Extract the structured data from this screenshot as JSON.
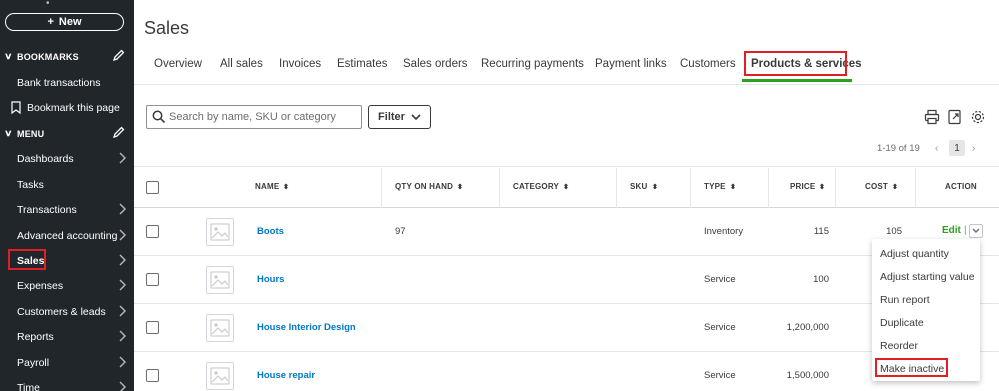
{
  "sidebar": {
    "new_label": "New",
    "bookmarks_label": "BOOKMARKS",
    "bookmark_items": [
      {
        "label": "Bank transactions"
      },
      {
        "label": "Bookmark this page"
      }
    ],
    "menu_label": "MENU",
    "menu_items": [
      {
        "label": "Dashboards"
      },
      {
        "label": "Tasks"
      },
      {
        "label": "Transactions"
      },
      {
        "label": "Advanced accounting"
      },
      {
        "label": "Sales"
      },
      {
        "label": "Expenses"
      },
      {
        "label": "Customers & leads"
      },
      {
        "label": "Reports"
      },
      {
        "label": "Payroll"
      },
      {
        "label": "Time"
      }
    ],
    "colors": {
      "bg": "#21262b",
      "text": "#ffffff"
    }
  },
  "page": {
    "title": "Sales"
  },
  "tabs": [
    {
      "label": "Overview"
    },
    {
      "label": "All sales"
    },
    {
      "label": "Invoices"
    },
    {
      "label": "Estimates"
    },
    {
      "label": "Sales orders"
    },
    {
      "label": "Recurring payments"
    },
    {
      "label": "Payment links"
    },
    {
      "label": "Customers"
    },
    {
      "label": "Products & services"
    }
  ],
  "active_tab": "Products & services",
  "toolbar": {
    "search_placeholder": "Search by name, SKU or category",
    "filter_label": "Filter",
    "icons": [
      "print-icon",
      "export-icon",
      "settings-icon"
    ]
  },
  "pager": {
    "range_text": "1-19 of 19",
    "prev": "‹",
    "page": "1",
    "next": "›"
  },
  "table": {
    "columns": [
      "NAME",
      "QTY ON HAND",
      "CATEGORY",
      "SKU",
      "TYPE",
      "PRICE",
      "COST",
      "ACTION"
    ],
    "rows": [
      {
        "name": "Boots",
        "qty": "97",
        "category": "",
        "sku": "",
        "type": "Inventory",
        "price": "115",
        "cost": "105",
        "action": "Edit"
      },
      {
        "name": "Hours",
        "qty": "",
        "category": "",
        "sku": "",
        "type": "Service",
        "price": "100",
        "cost": "",
        "action": ""
      },
      {
        "name": "House Interior Design",
        "qty": "",
        "category": "",
        "sku": "",
        "type": "Service",
        "price": "1,200,000",
        "cost": "",
        "action": ""
      },
      {
        "name": "House repair",
        "qty": "",
        "category": "",
        "sku": "",
        "type": "Service",
        "price": "1,500,000",
        "cost": "",
        "action": ""
      }
    ]
  },
  "action_menu": {
    "items": [
      {
        "label": "Adjust quantity"
      },
      {
        "label": "Adjust starting value"
      },
      {
        "label": "Run report"
      },
      {
        "label": "Duplicate"
      },
      {
        "label": "Reorder"
      },
      {
        "label": "Make inactive"
      }
    ],
    "highlighted": "Make inactive"
  },
  "colors": {
    "accent_green": "#2ca01c",
    "link_blue": "#0077c5",
    "highlight_red": "#e01e26"
  }
}
